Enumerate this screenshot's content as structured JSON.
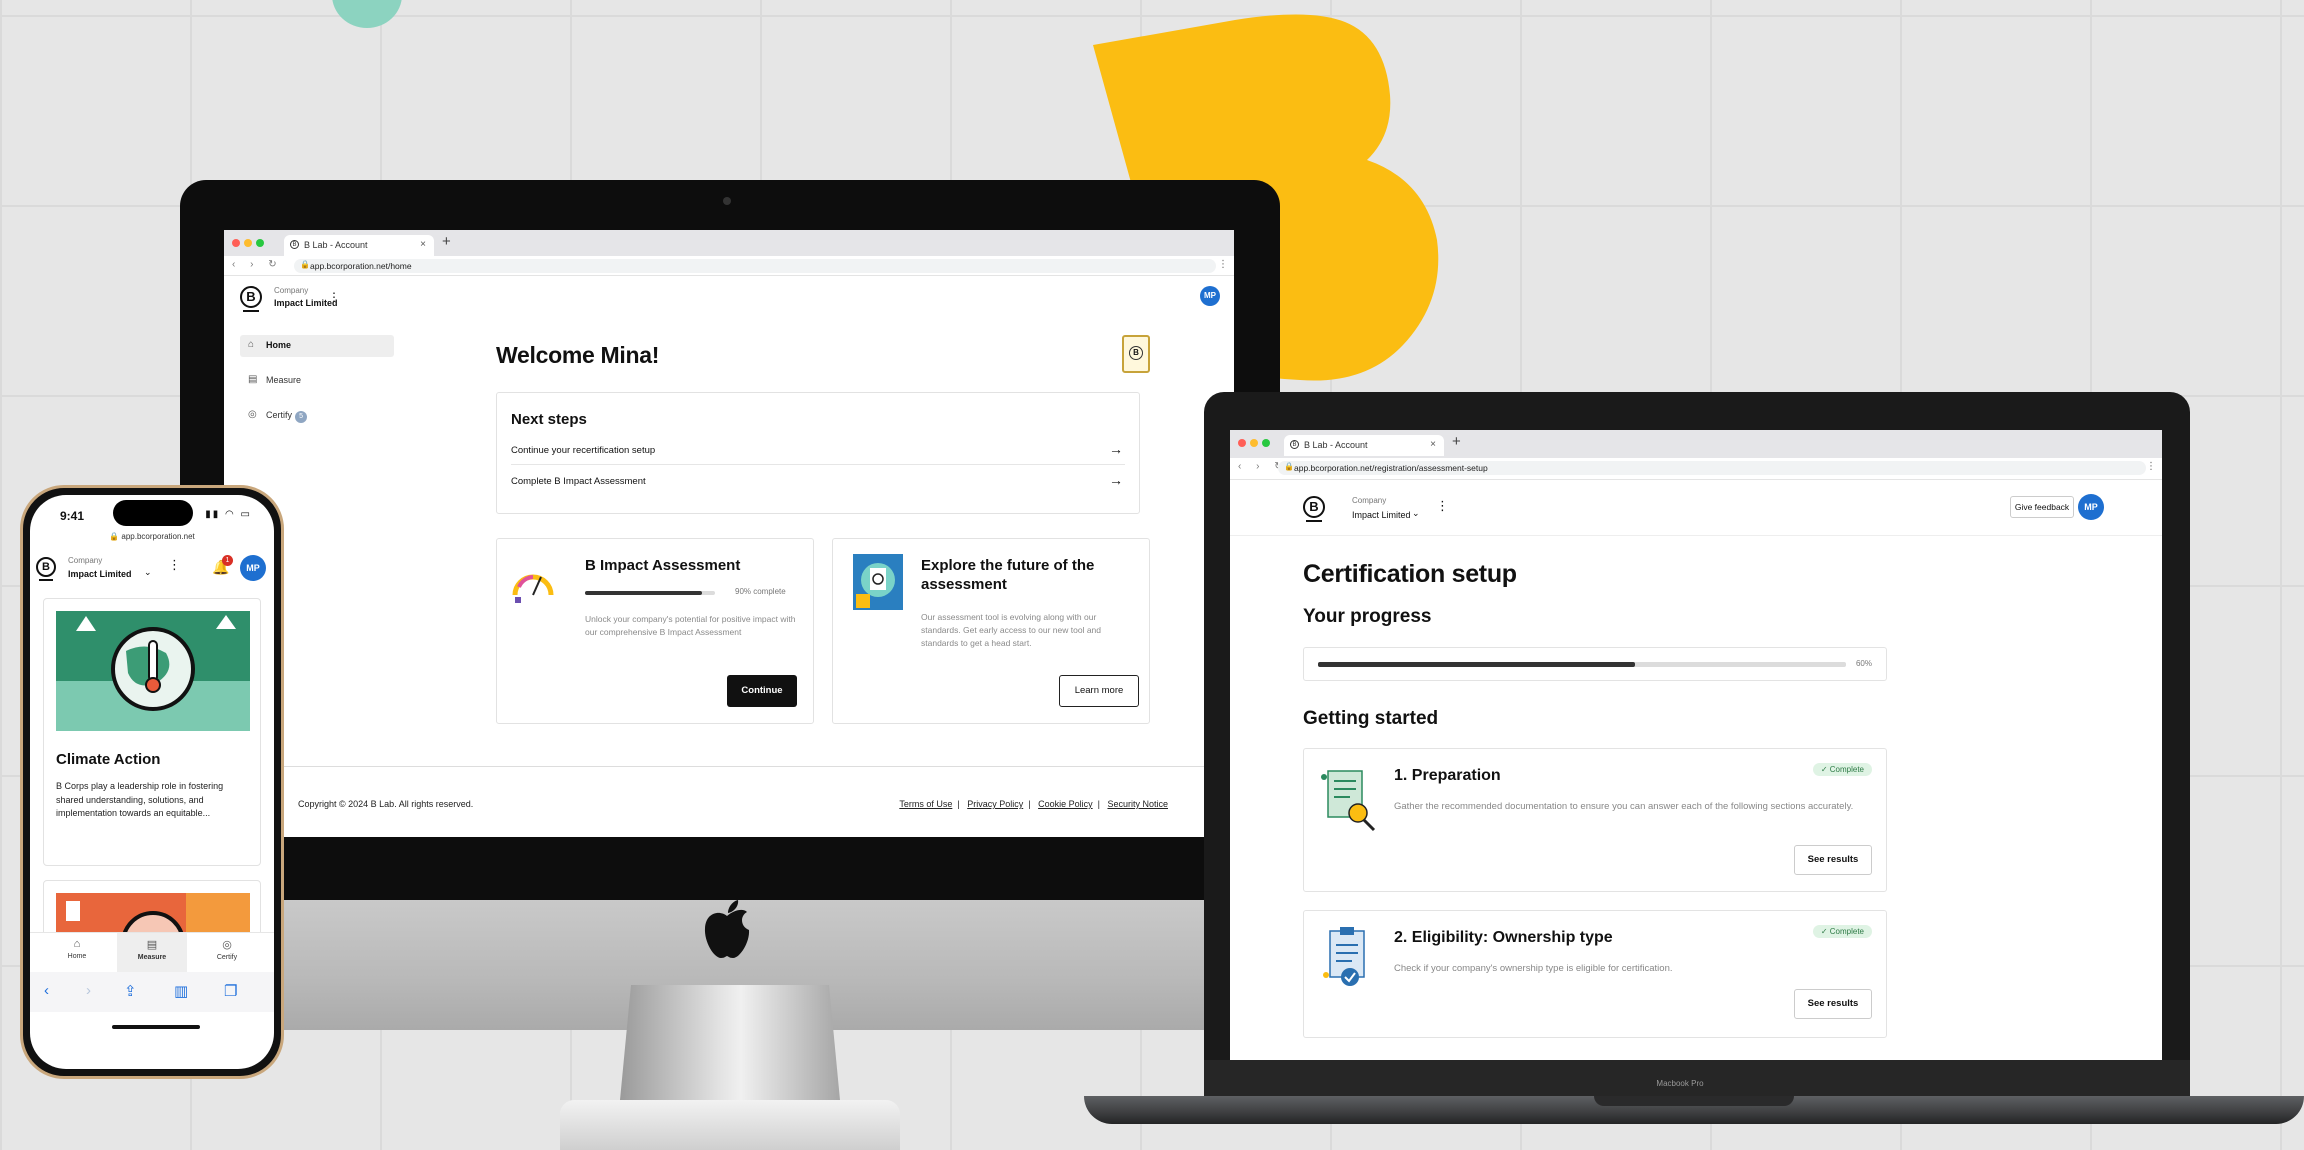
{
  "imac": {
    "tab_title": "B Lab - Account",
    "url": "app.bcorporation.net/home",
    "company_label": "Company",
    "company_name": "Impact Limited",
    "avatar": "MP",
    "sidebar": [
      {
        "label": "Home",
        "icon": "home-icon",
        "active": true
      },
      {
        "label": "Measure",
        "icon": "clipboard-icon",
        "active": false
      },
      {
        "label": "Certify",
        "icon": "check-circle-icon",
        "active": false,
        "badge": "5"
      }
    ],
    "welcome": "Welcome Mina!",
    "next_steps": {
      "title": "Next steps",
      "items": [
        "Continue your recertification setup",
        "Complete B Impact Assessment"
      ]
    },
    "impact_card": {
      "title": "B Impact Assessment",
      "progress_label": "90% complete",
      "progress": 0.9,
      "text": "Unlock your company's potential for positive impact with our comprehensive B Impact Assessment",
      "button": "Continue"
    },
    "future_card": {
      "title": "Explore the future of the assessment",
      "text": "Our assessment tool is evolving along with our standards. Get early access to our new tool and standards to get a head start.",
      "button": "Learn more"
    },
    "footer": {
      "copyright": "Copyright © 2024 B Lab. All rights reserved.",
      "links": [
        "Terms of Use",
        "Privacy Policy",
        "Cookie Policy",
        "Security Notice"
      ]
    }
  },
  "macbook": {
    "tab_title": "B Lab - Account",
    "url": "app.bcorporation.net/registration/assessment-setup",
    "company_label": "Company",
    "company_name": "Impact Limited",
    "give_feedback": "Give feedback",
    "avatar": "MP",
    "title": "Certification setup",
    "progress_heading": "Your progress",
    "progress_label": "60%",
    "progress": 0.6,
    "getting_started": "Getting started",
    "sections": [
      {
        "title": "1. Preparation",
        "badge": "✓ Complete",
        "text": "Gather the recommended documentation to ensure you can answer each of the following sections accurately.",
        "button": "See results"
      },
      {
        "title": "2. Eligibility: Ownership type",
        "badge": "✓ Complete",
        "text": "Check if your company's ownership type is eligible for certification.",
        "button": "See results"
      }
    ],
    "device_label": "Macbook Pro"
  },
  "phone": {
    "time": "9:41",
    "url": "app.bcorporation.net",
    "company_label": "Company",
    "company_name": "Impact Limited",
    "notification_count": "1",
    "avatar": "MP",
    "card_title": "Climate Action",
    "card_text": "B Corps play a leadership role in fostering shared understanding, solutions, and implementation towards an equitable...",
    "nav": [
      {
        "label": "Home",
        "icon": "home-icon"
      },
      {
        "label": "Measure",
        "icon": "clipboard-icon",
        "active": true
      },
      {
        "label": "Certify",
        "icon": "check-circle-icon"
      }
    ]
  },
  "colors": {
    "background": "#e6e6e6",
    "brand_yellow": "#fbbd12",
    "teal": "#8cd3c0",
    "avatar_blue": "#1e6fd0",
    "complete_green": "#dff3e4"
  }
}
